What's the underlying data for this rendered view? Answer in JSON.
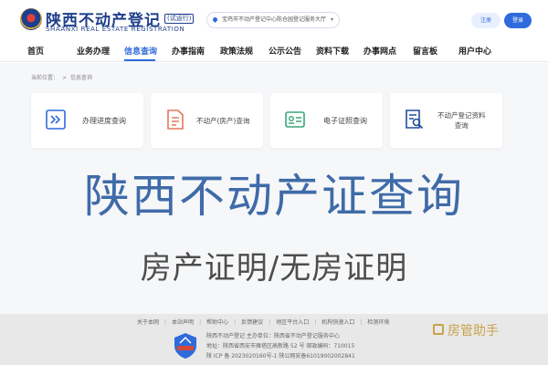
{
  "header": {
    "title_cn": "陕西不动产登记",
    "badge": "(试运行)",
    "title_en": "SHAANXI REAL ESTATE REGISTRATION",
    "location": "宝鸡市不动产登记中心陈仓园登记服务大厅",
    "register_label": "注册",
    "login_label": "登录"
  },
  "nav": {
    "items": [
      "首页",
      "业务办理",
      "信息查询",
      "办事指南",
      "政策法规",
      "公示公告",
      "资料下载",
      "办事网点",
      "留言板",
      "用户中心"
    ],
    "active_index": 2
  },
  "breadcrumb": {
    "prefix": "当前位置：",
    "current": "信息查询"
  },
  "cards": [
    {
      "label": "办理进度查询",
      "icon": "progress-icon"
    },
    {
      "label": "不动产(房产)查询",
      "icon": "property-doc-icon"
    },
    {
      "label": "电子证照查询",
      "icon": "certificate-icon"
    },
    {
      "label": "不动产登记资料\n查询",
      "icon": "search-doc-icon"
    }
  ],
  "overlay": {
    "title": "陕西不动产证查询",
    "subtitle": "房产证明/无房证明"
  },
  "footer": {
    "links": [
      "关于本网",
      "本站声明",
      "帮助中心",
      "反馈建议",
      "地区平台入口",
      "机构快速入口",
      "检测环境"
    ],
    "line1": "陕西不动产登记       主办单位：陕西省不动产登记服务中心",
    "line2": "地址：陕西省西安市雁塔区高新路 52 号     邮政编码：710015",
    "line3": "陕 ICP 备 2023020160号-1    陕公网安备61019002002841",
    "watermark": "房管助手"
  },
  "colors": {
    "brand": "#1f3f8a",
    "accent": "#2f6bdc",
    "title": "#3f6ba8"
  }
}
